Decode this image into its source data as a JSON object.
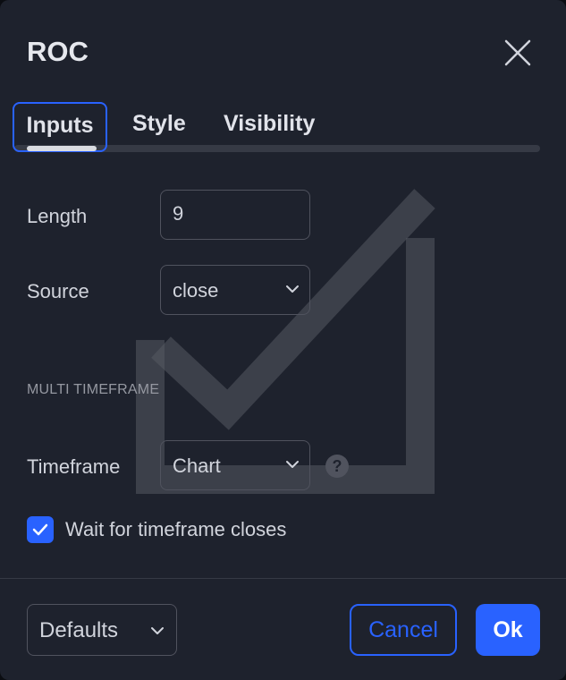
{
  "dialog": {
    "title": "ROC",
    "close_icon": "close-icon"
  },
  "tabs": [
    {
      "label": "Inputs",
      "active": true
    },
    {
      "label": "Style",
      "active": false
    },
    {
      "label": "Visibility",
      "active": false
    }
  ],
  "inputs": {
    "length": {
      "label": "Length",
      "value": "9"
    },
    "source": {
      "label": "Source",
      "value": "close"
    },
    "section_title": "MULTI TIMEFRAME",
    "timeframe": {
      "label": "Timeframe",
      "value": "Chart",
      "help_icon": "question-circle-icon"
    },
    "wait_closes": {
      "label": "Wait for timeframe closes",
      "checked": true
    }
  },
  "footer": {
    "defaults_label": "Defaults",
    "cancel_label": "Cancel",
    "ok_label": "Ok"
  },
  "colors": {
    "background": "#1e222d",
    "accent": "#2962ff",
    "text": "#d1d4dc",
    "border": "#50535e"
  }
}
